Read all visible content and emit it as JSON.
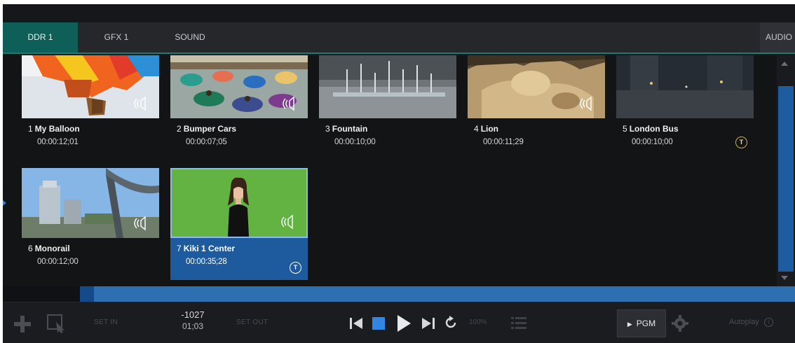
{
  "tabs": [
    {
      "label": "DDR 1",
      "active": true
    },
    {
      "label": "GFX 1",
      "active": false
    },
    {
      "label": "SOUND",
      "active": false
    }
  ],
  "audio_tab": {
    "label": "AUDIO"
  },
  "clips": [
    {
      "number": "1",
      "name": "My Balloon",
      "duration": "00:00:12;01",
      "audio_icon": "speaker-icon",
      "badge": ""
    },
    {
      "number": "2",
      "name": "Bumper Cars",
      "duration": "00:00:07;05",
      "audio_icon": "speaker-icon",
      "badge": ""
    },
    {
      "number": "3",
      "name": "Fountain",
      "duration": "00:00:10;00",
      "audio_icon": "",
      "badge": ""
    },
    {
      "number": "4",
      "name": "Lion",
      "duration": "00:00:11;29",
      "audio_icon": "speaker-icon",
      "badge": ""
    },
    {
      "number": "5",
      "name": "London Bus",
      "duration": "00:00:10;00",
      "audio_icon": "",
      "badge": "T"
    },
    {
      "number": "6",
      "name": "Monorail",
      "duration": "00:00:12;00",
      "audio_icon": "speaker-icon",
      "badge": ""
    },
    {
      "number": "7",
      "name": "Kiki 1 Center",
      "duration": "00:00:35;28",
      "audio_icon": "speaker-icon",
      "badge": "T",
      "selected": true
    }
  ],
  "transport": {
    "set_in": "SET IN",
    "set_out": "SET OUT",
    "time_remaining": "-1027",
    "time_position": "01;03",
    "speed": "100%",
    "pgm_label": "PGM",
    "autoplay_label": "Autoplay"
  },
  "colors": {
    "accent": "#1d7a72",
    "selection": "#1e5a9e",
    "scrub": "#2d6fb0",
    "stop": "#2f86e5",
    "badge": "#e0a93a"
  }
}
